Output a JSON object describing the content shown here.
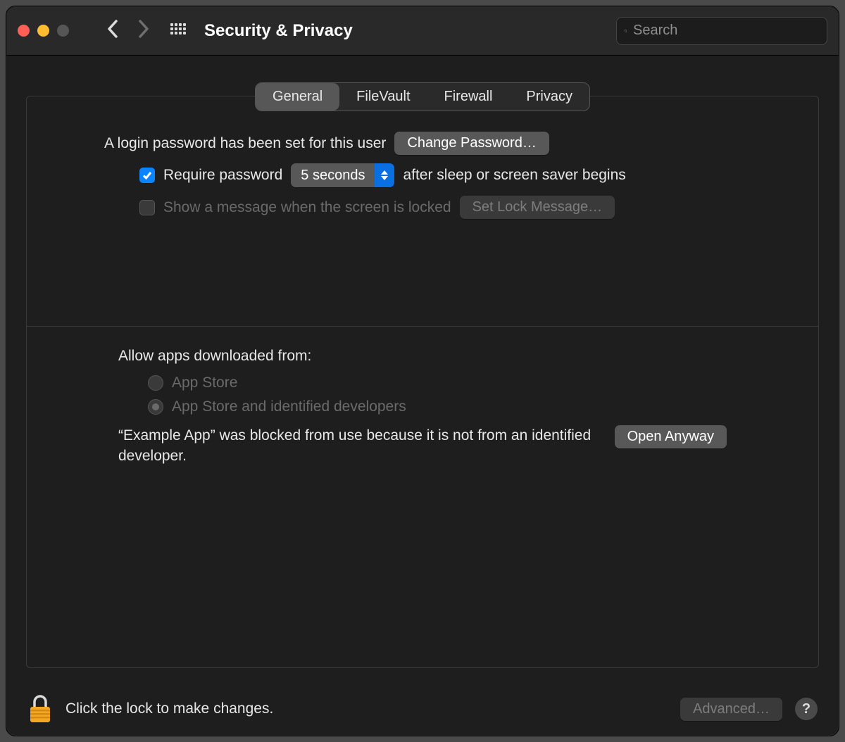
{
  "window": {
    "title": "Security & Privacy"
  },
  "search": {
    "placeholder": "Search",
    "value": ""
  },
  "tabs": [
    {
      "label": "General",
      "selected": true
    },
    {
      "label": "FileVault",
      "selected": false
    },
    {
      "label": "Firewall",
      "selected": false
    },
    {
      "label": "Privacy",
      "selected": false
    }
  ],
  "login": {
    "password_set_text": "A login password has been set for this user",
    "change_password_label": "Change Password…",
    "require_password_label": "Require password",
    "require_password_checked": true,
    "delay_selected": "5 seconds",
    "after_text": "after sleep or screen saver begins",
    "show_message_label": "Show a message when the screen is locked",
    "show_message_checked": false,
    "set_lock_message_label": "Set Lock Message…"
  },
  "downloads": {
    "heading": "Allow apps downloaded from:",
    "options": [
      {
        "label": "App Store",
        "selected": false
      },
      {
        "label": "App Store and identified developers",
        "selected": true
      }
    ],
    "blocked_message": "“Example App” was blocked from use because it is not from an identified developer.",
    "open_anyway_label": "Open Anyway"
  },
  "footer": {
    "lock_text": "Click the lock to make changes.",
    "advanced_label": "Advanced…",
    "help_label": "?"
  }
}
